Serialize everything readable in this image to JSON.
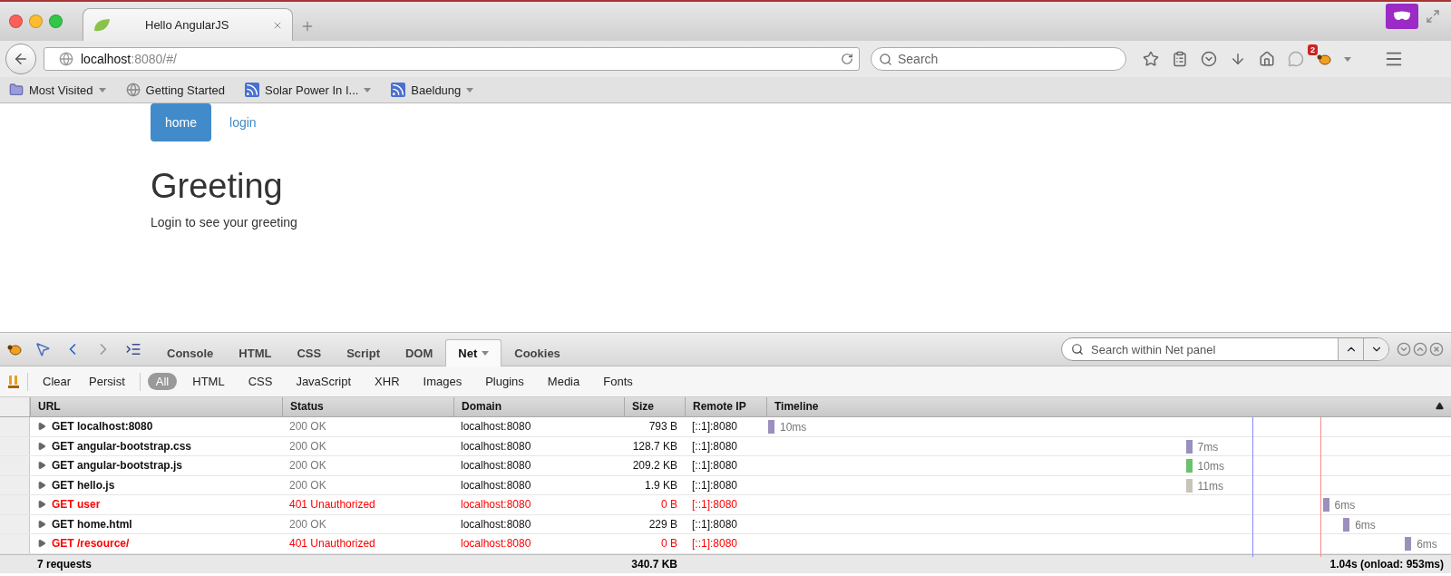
{
  "browser": {
    "tab_title": "Hello AngularJS",
    "url_host": "localhost",
    "url_rest": ":8080/#/",
    "search_placeholder": "Search",
    "notification_count": "2"
  },
  "bookmarks": [
    {
      "label": "Most Visited",
      "kind": "folder",
      "dropdown": true
    },
    {
      "label": "Getting Started",
      "kind": "globe",
      "dropdown": false
    },
    {
      "label": "Solar Power In I...",
      "kind": "feed",
      "dropdown": true
    },
    {
      "label": "Baeldung",
      "kind": "feed",
      "dropdown": true
    }
  ],
  "page": {
    "nav": [
      {
        "label": "home",
        "selected": true
      },
      {
        "label": "login",
        "selected": false
      }
    ],
    "heading": "Greeting",
    "text": "Login to see your greeting"
  },
  "devtools": {
    "tabs": [
      {
        "label": "Console",
        "selected": false
      },
      {
        "label": "HTML",
        "selected": false
      },
      {
        "label": "CSS",
        "selected": false
      },
      {
        "label": "Script",
        "selected": false
      },
      {
        "label": "DOM",
        "selected": false
      },
      {
        "label": "Net",
        "selected": true
      },
      {
        "label": "Cookies",
        "selected": false
      }
    ],
    "search_placeholder": "Search within Net panel",
    "actions": [
      "Clear",
      "Persist"
    ],
    "filters": [
      {
        "label": "All",
        "selected": true
      },
      {
        "label": "HTML",
        "selected": false
      },
      {
        "label": "CSS",
        "selected": false
      },
      {
        "label": "JavaScript",
        "selected": false
      },
      {
        "label": "XHR",
        "selected": false
      },
      {
        "label": "Images",
        "selected": false
      },
      {
        "label": "Plugins",
        "selected": false
      },
      {
        "label": "Media",
        "selected": false
      },
      {
        "label": "Fonts",
        "selected": false
      }
    ],
    "columns": [
      "URL",
      "Status",
      "Domain",
      "Size",
      "Remote IP",
      "Timeline"
    ],
    "rows": [
      {
        "request": "GET localhost:8080",
        "status": "200 OK",
        "domain": "localhost:8080",
        "size": "793 B",
        "remote_ip": "[::1]:8080",
        "time": "10ms",
        "color": "#9b8fbd",
        "error": false
      },
      {
        "request": "GET angular-bootstrap.css",
        "status": "200 OK",
        "domain": "localhost:8080",
        "size": "128.7 KB",
        "remote_ip": "[::1]:8080",
        "time": "7ms",
        "color": "#9b8fbd",
        "error": false
      },
      {
        "request": "GET angular-bootstrap.js",
        "status": "200 OK",
        "domain": "localhost:8080",
        "size": "209.2 KB",
        "remote_ip": "[::1]:8080",
        "time": "10ms",
        "color": "#6cc16c",
        "error": false
      },
      {
        "request": "GET hello.js",
        "status": "200 OK",
        "domain": "localhost:8080",
        "size": "1.9 KB",
        "remote_ip": "[::1]:8080",
        "time": "11ms",
        "color": "#c8c4b8",
        "error": false
      },
      {
        "request": "GET user",
        "status": "401 Unauthorized",
        "domain": "localhost:8080",
        "size": "0 B",
        "remote_ip": "[::1]:8080",
        "time": "6ms",
        "color": "#9b8fbd",
        "error": true
      },
      {
        "request": "GET home.html",
        "status": "200 OK",
        "domain": "localhost:8080",
        "size": "229 B",
        "remote_ip": "[::1]:8080",
        "time": "6ms",
        "color": "#9b8fbd",
        "error": false
      },
      {
        "request": "GET /resource/",
        "status": "401 Unauthorized",
        "domain": "localhost:8080",
        "size": "0 B",
        "remote_ip": "[::1]:8080",
        "time": "6ms",
        "color": "#9b8fbd",
        "error": true
      }
    ],
    "summary": {
      "requests": "7 requests",
      "size": "340.7 KB",
      "total": "1.04s (onload: 953ms)"
    }
  }
}
